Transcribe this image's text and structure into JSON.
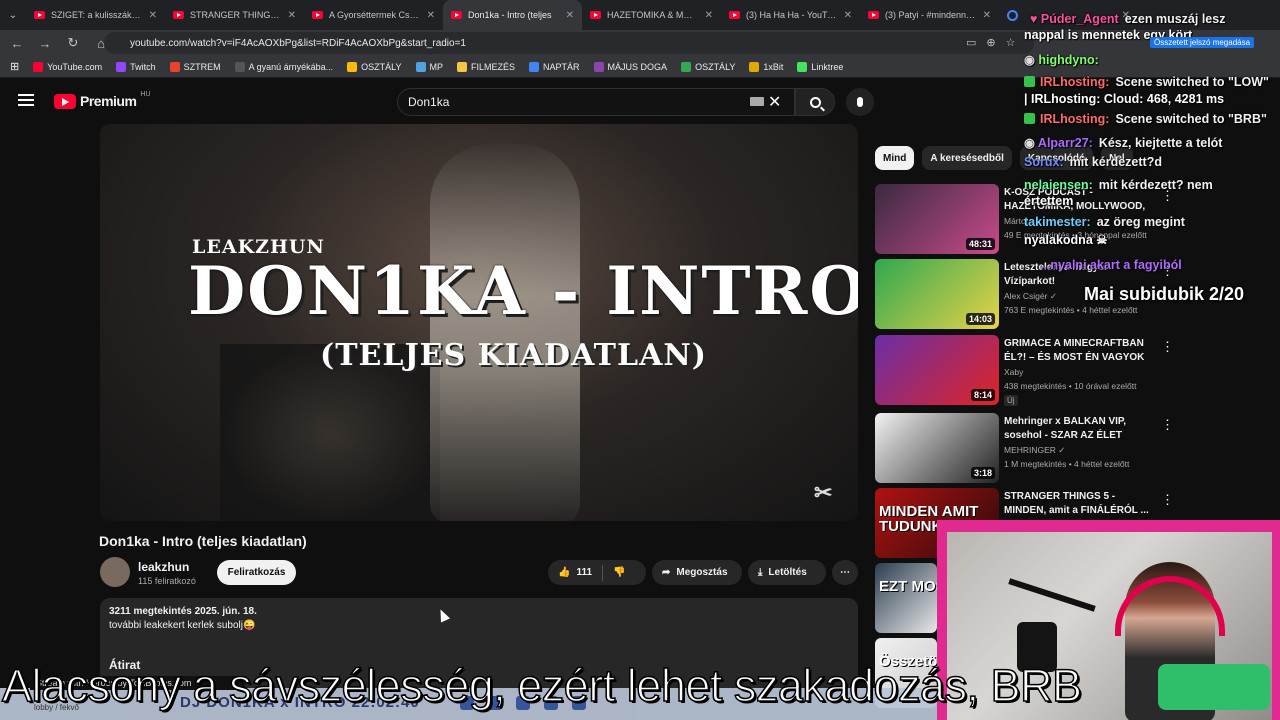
{
  "browser": {
    "tabs": [
      {
        "title": "SZIGET: a kulisszák mögü",
        "icon": "youtube-icon",
        "active": false
      },
      {
        "title": "STRANGER THINGS 5 - M",
        "icon": "youtube-icon",
        "active": false
      },
      {
        "title": "A Gyorséttermek Csúfos B",
        "icon": "youtube-icon",
        "active": false
      },
      {
        "title": "Don1ka - Intro (teljes",
        "icon": "youtube-icon",
        "active": true
      },
      {
        "title": "HAZETOMIKA & MOLLYW",
        "icon": "youtube-icon",
        "active": false
      },
      {
        "title": "(3) Ha Ha Ha - YouTube",
        "icon": "youtube-icon",
        "active": false
      },
      {
        "title": "(3) Patyi - #mindennapo",
        "icon": "youtube-icon",
        "active": false
      },
      {
        "title": "",
        "icon": "google-icon",
        "active": false
      }
    ],
    "url": "youtube.com/watch?v=iF4AcAOXbPg&list=RDiF4AcAOXbPg&start_radio=1",
    "bookmarks": [
      {
        "label": "YouTube.com",
        "color": "#ff0033"
      },
      {
        "label": "Twitch",
        "color": "#9146ff"
      },
      {
        "label": "SZTREM",
        "color": "#e8432b"
      },
      {
        "label": "A gyanú árnyékába...",
        "color": "#555555"
      },
      {
        "label": "OSZTÁLY",
        "color": "#fbbc04"
      },
      {
        "label": "MP",
        "color": "#4fa3e0"
      },
      {
        "label": "FILMEZÉS",
        "color": "#f2c744"
      },
      {
        "label": "NAPTÁR",
        "color": "#4285f4"
      },
      {
        "label": "MÁJUS DOGA",
        "color": "#8e44ad"
      },
      {
        "label": "OSZTÁLY",
        "color": "#34a853"
      },
      {
        "label": "1xBit",
        "color": "#e0a800"
      },
      {
        "label": "Linktree",
        "color": "#43e55e"
      }
    ]
  },
  "youtube": {
    "logo_text": "Premium",
    "region": "HU",
    "search_value": "Don1ka",
    "video": {
      "overlay_artist": "LEAKZHUN",
      "overlay_title": "DON1KA - INTRO",
      "overlay_subtitle": "(TELJES KIADATLAN)",
      "title": "Don1ka - Intro (teljes kiadatlan)",
      "channel": "leakzhun",
      "subscribers": "115 feliratkozó",
      "subscribe_label": "Feliratkozás",
      "likes": "111",
      "share_label": "Megosztás",
      "download_label": "Letöltés",
      "more_label": "⋯",
      "description_meta": "3211 megtekintés  2025. jún. 18.",
      "description_text": "további leakekert kerlek subolj😜",
      "transcript_label": "Átirat"
    },
    "chips": [
      "Mind",
      "A keresésedből",
      "Kapcsolódó",
      "Nel"
    ],
    "recommendations": [
      {
        "title": "K-OSZ PODCAST - HAZETOMIKA, MOLLYWOOD, ...",
        "channel": "Márto...",
        "views": "49 E megtekintés • 3 hónappal ezelőtt",
        "duration": "48:31",
        "thumb": [
          "#3a2a40",
          "#c84b8a"
        ]
      },
      {
        "title": "Letesztelem a magyar Vízíparkot!",
        "channel": "Alex Csigér ✓",
        "views": "763 E megtekintés • 4 héttel ezelőtt",
        "duration": "14:03",
        "thumb": [
          "#2fa84f",
          "#e8d24a"
        ]
      },
      {
        "title": "GRIMACE A MINECRAFTBAN ÉL?! – ÉS MOST ÉN VAGYOK A...",
        "channel": "Xaby",
        "views": "438 megtekintés • 10 órával ezelőtt",
        "duration": "8:14",
        "thumb": [
          "#6a2ea8",
          "#e02424"
        ],
        "badge": "Új"
      },
      {
        "title": "Mehringer x BALKAN VIP, sosehol - SZAR AZ ÉLET",
        "channel": "MEHRINGER ✓",
        "views": "1 M megtekintés • 4 héttel ezelőtt",
        "duration": "3:18",
        "thumb": [
          "#f2f2f2",
          "#222222"
        ]
      },
      {
        "title": "STRANGER THINGS 5 - MINDEN, amit a FINÁLÉRÓL ...",
        "channel": "",
        "views": "",
        "duration": "",
        "thumb": [
          "#b01212",
          "#2a0a0a"
        ],
        "thumb_text": "MINDEN AMIT TUDUNK"
      },
      {
        "title": "",
        "channel": "",
        "views": "",
        "duration": "",
        "thumb": [
          "#2c3e50",
          "#e8e8e8"
        ],
        "thumb_text": "EZT MOS"
      },
      {
        "title": "",
        "channel": "",
        "views": "",
        "duration": "",
        "thumb": [
          "#f0f0f0",
          "#cccccc"
        ],
        "thumb_text": "Összetört alatt"
      }
    ]
  },
  "stream": {
    "chat": [
      {
        "user": "Púder_Agent",
        "color": "#ff4fa0",
        "text": "ezen muszáj lesz",
        "icon": "heart-icon"
      },
      {
        "user": "",
        "color": "#ffffff",
        "text": "nappal is mennetek egy kört",
        "icon": ""
      },
      {
        "user": "highdyno:",
        "color": "#7fff6a",
        "text": "",
        "icon": "moderator-icon"
      },
      {
        "user": "IRLhosting:",
        "color": "#ff6a6a",
        "text": "Scene switched to \"LOW\"",
        "icon": "check-icon"
      },
      {
        "user": "",
        "color": "#ffffff",
        "text": "| IRLhosting: Cloud: 468, 4281 ms",
        "icon": ""
      },
      {
        "user": "IRLhosting:",
        "color": "#ff6a6a",
        "text": "Scene switched to \"BRB\"",
        "icon": "check-icon"
      },
      {
        "user": "Alparr27:",
        "color": "#b06aff",
        "text": "Kész, kiejtette a telót",
        "icon": "moderator-icon"
      },
      {
        "user": "Sorux:",
        "color": "#6a8cff",
        "text": "mit kérdezett?d",
        "icon": ""
      },
      {
        "user": "nelaiensen:",
        "color": "#6aff9e",
        "text": "mit kérdezett? nem",
        "icon": ""
      },
      {
        "user": "",
        "color": "#ffffff",
        "text": "értettem",
        "icon": ""
      },
      {
        "user": "takimester:",
        "color": "#6ad0ff",
        "text": "az öreg megint",
        "icon": ""
      },
      {
        "user": "",
        "color": "#ffffff",
        "text": "nyalakodna",
        "icon": "skull-emote-icon"
      },
      {
        "user": "",
        "color": "#b06aff",
        "text": "...nyalni akart a fagyiból",
        "icon": ""
      }
    ],
    "goal_text": "Mai subidubik 2/20",
    "gift_notice": "Összetett jelszó megadása",
    "subtitle": "Alacsony a sávszélesség, ezért lehet szakadozás, BRB",
    "stream_tag": "Stream with Heroes by ToHBliples.com",
    "lobby_label": "lobby / fekvő",
    "taskbar_text": "DJ DON1KA x INTRO 22:02:40"
  }
}
